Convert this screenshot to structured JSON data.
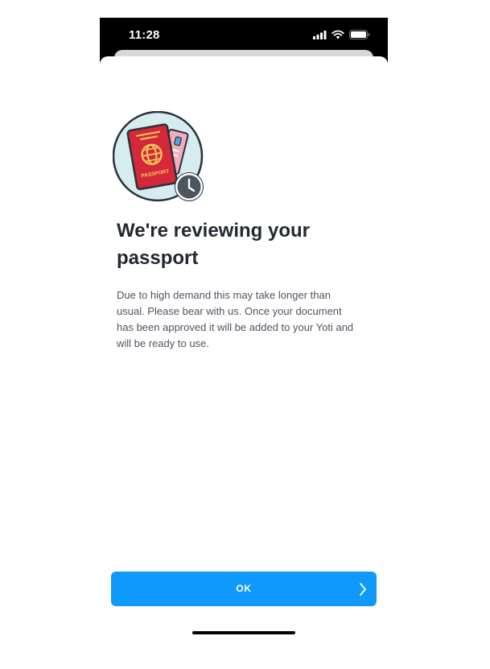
{
  "status_bar": {
    "time": "11:28",
    "icons": [
      "cellular-signal-icon",
      "wifi-icon",
      "battery-icon"
    ]
  },
  "illustration": {
    "icon": "passport-review-icon",
    "passport_label": "PASSPORT",
    "colors": {
      "circle_bg": "#d6ecee",
      "passport": "#d5283a",
      "emblem": "#f3c95b",
      "card": "#f4aeb8",
      "clock": "#4b5560",
      "outline": "#2a323c"
    }
  },
  "main": {
    "title": "We're reviewing your passport",
    "description": "Due to high demand this may take longer than usual. Please bear with us. Once your document has been approved it will be added to your Yoti and will be ready to use."
  },
  "actions": {
    "ok_label": "OK",
    "ok_icon": "chevron-right-icon",
    "button_color": "#0f99fa"
  }
}
